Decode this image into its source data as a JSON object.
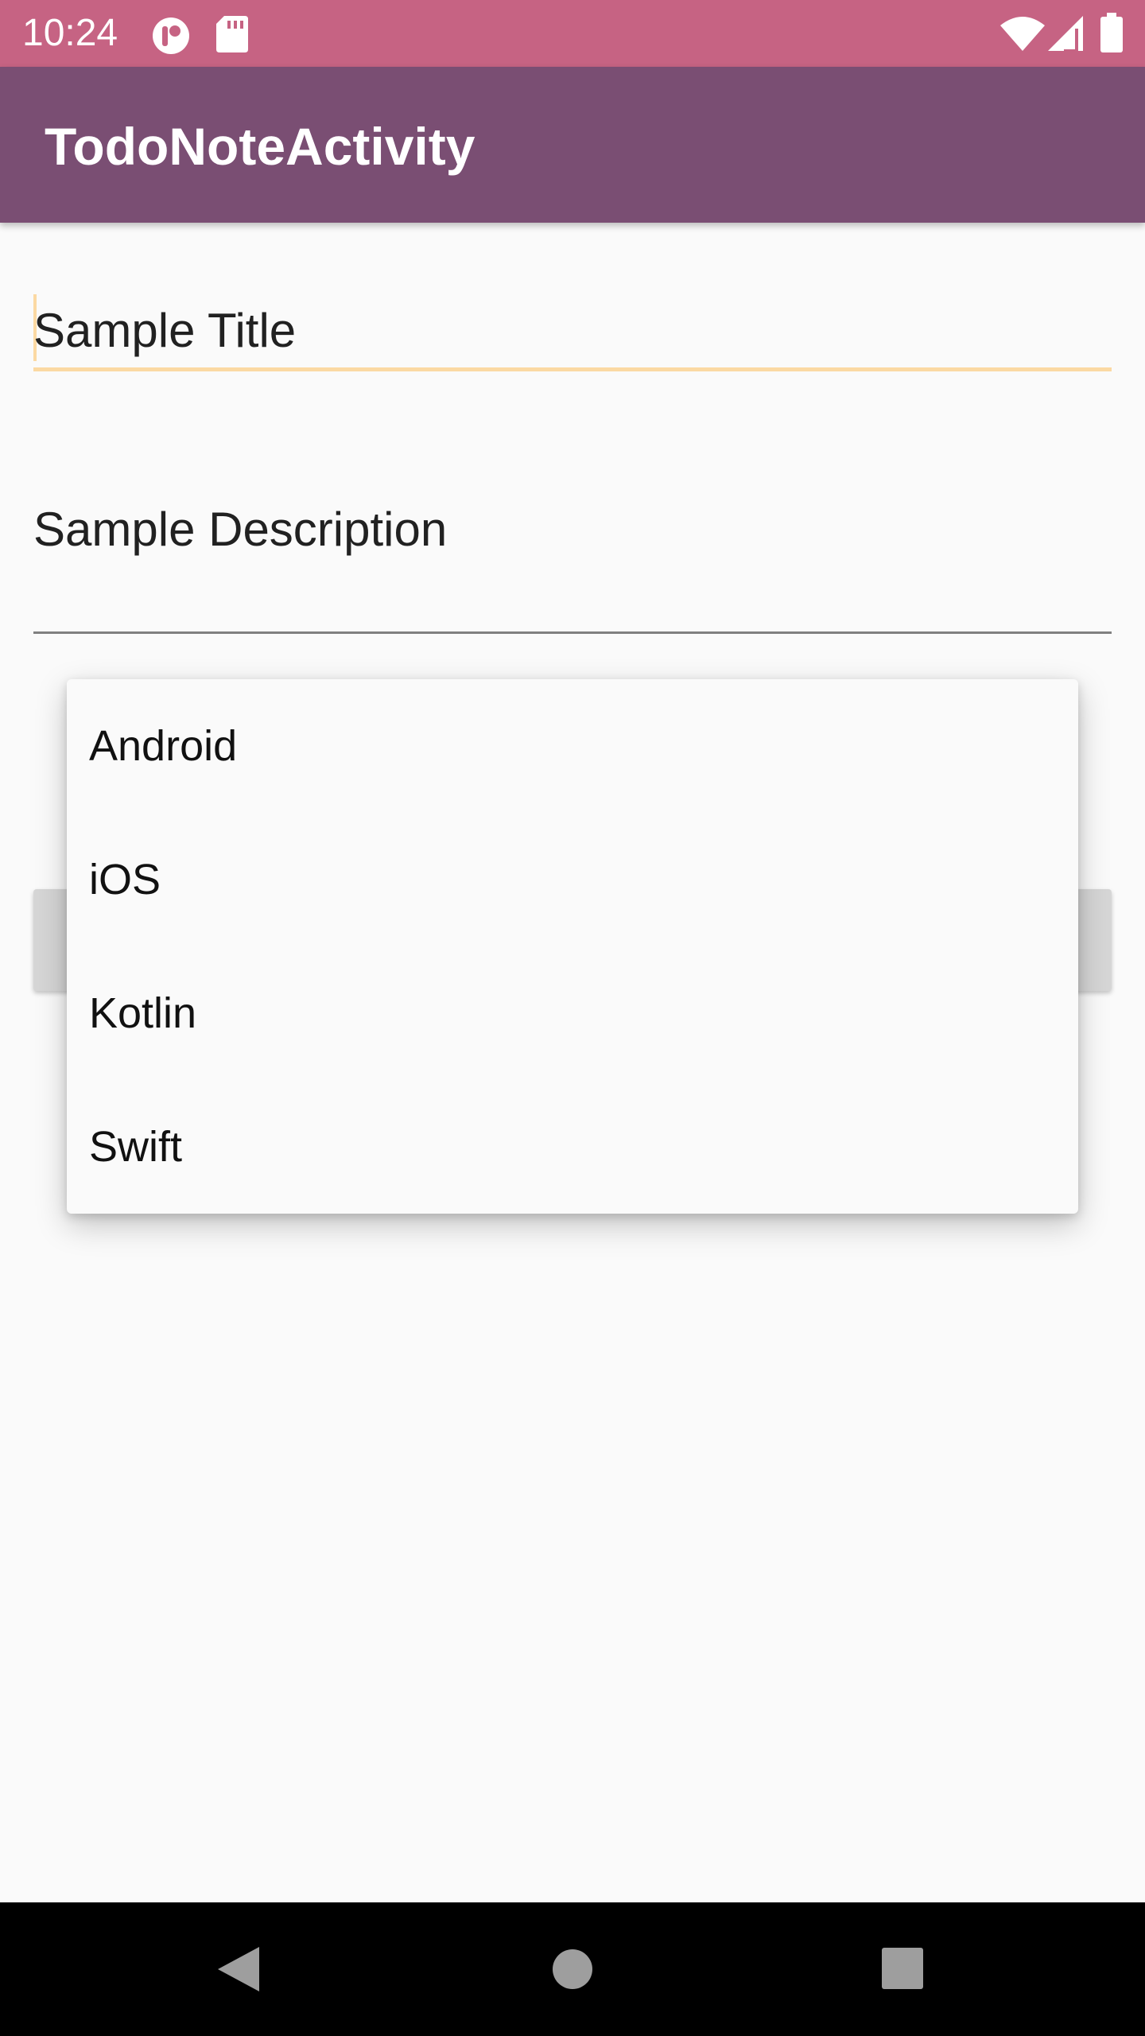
{
  "status_bar": {
    "time": "10:24",
    "left_icons": [
      "notification-app-icon",
      "sd-card-icon"
    ],
    "right_icons": [
      "wifi-icon",
      "cell-signal-icon",
      "battery-icon"
    ]
  },
  "app_bar": {
    "title": "TodoNoteActivity"
  },
  "form": {
    "title_value": "Sample Title",
    "description_value": "Sample Description"
  },
  "dropdown": {
    "options": [
      {
        "label": "Android"
      },
      {
        "label": "iOS"
      },
      {
        "label": "Kotlin"
      },
      {
        "label": "Swift"
      }
    ]
  },
  "nav_bar": {
    "buttons": [
      "back-icon",
      "home-icon",
      "recents-icon"
    ]
  },
  "colors": {
    "status_bar": "#c66383",
    "app_bar": "#7a4e73",
    "accent_underline": "#fbd9a3",
    "background": "#fafafa"
  }
}
